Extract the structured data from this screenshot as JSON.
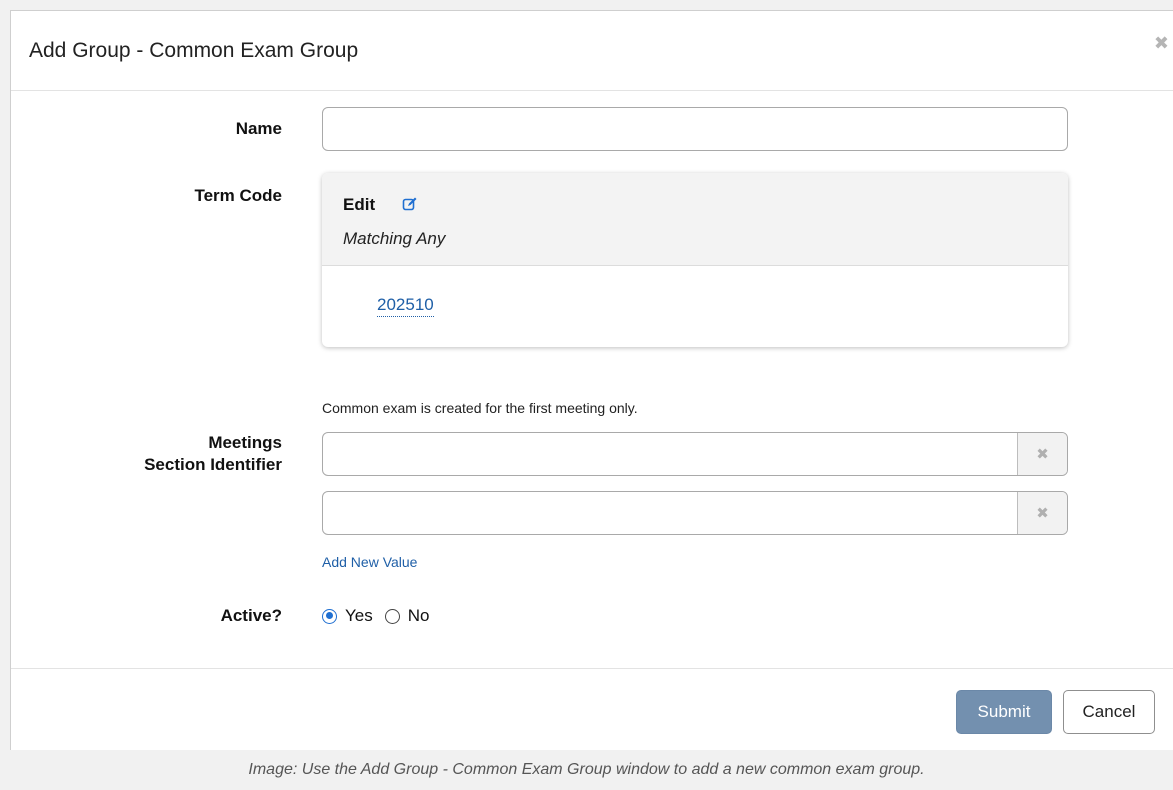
{
  "dialog": {
    "title": "Add Group - Common Exam Group",
    "close_icon": "close-icon"
  },
  "form": {
    "name_label": "Name",
    "name_value": "",
    "term_code_label": "Term Code",
    "term_code": {
      "edit_label": "Edit",
      "edit_icon": "edit-icon",
      "matching_text": "Matching Any",
      "values": [
        "202510"
      ]
    },
    "meetings_note": "Common exam is created for the first meeting only.",
    "meetings_label_line1": "Meetings",
    "meetings_label_line2": "Section Identifier",
    "section_identifiers": [
      "",
      ""
    ],
    "add_new_value": "Add New Value",
    "active_label": "Active?",
    "active_options": [
      "Yes",
      "No"
    ],
    "active_selected": "Yes"
  },
  "footer": {
    "submit_label": "Submit",
    "cancel_label": "Cancel"
  },
  "caption": "Image: Use the Add Group - Common Exam Group window to add a new common exam group.",
  "colors": {
    "link": "#1f5fa7",
    "submit_bg": "#7390af",
    "radio_accent": "#1f6fd1"
  }
}
